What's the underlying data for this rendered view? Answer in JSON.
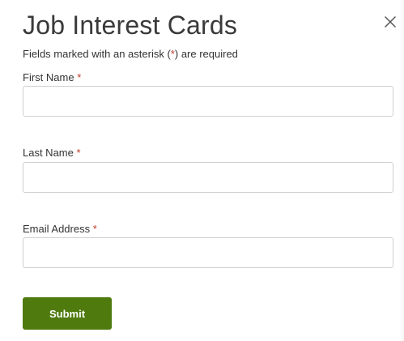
{
  "modal": {
    "title": "Job Interest Cards",
    "close_icon": "close-icon",
    "required_note": {
      "before": "Fields marked with an asterisk ",
      "open_paren": "(",
      "asterisk": "*",
      "close_paren": ")",
      "after": " are required"
    }
  },
  "form": {
    "fields": [
      {
        "label": "First Name",
        "required_marker": "*",
        "value": "",
        "placeholder": ""
      },
      {
        "label": "Last Name",
        "required_marker": "*",
        "value": "",
        "placeholder": ""
      },
      {
        "label": "Email Address",
        "required_marker": "*",
        "value": "",
        "placeholder": ""
      }
    ],
    "submit_label": "Submit"
  },
  "colors": {
    "submit_background": "#4f7a0e",
    "required_asterisk": "#c0392b",
    "title_text": "#3a3a3a",
    "input_border": "#cfcfcf"
  }
}
